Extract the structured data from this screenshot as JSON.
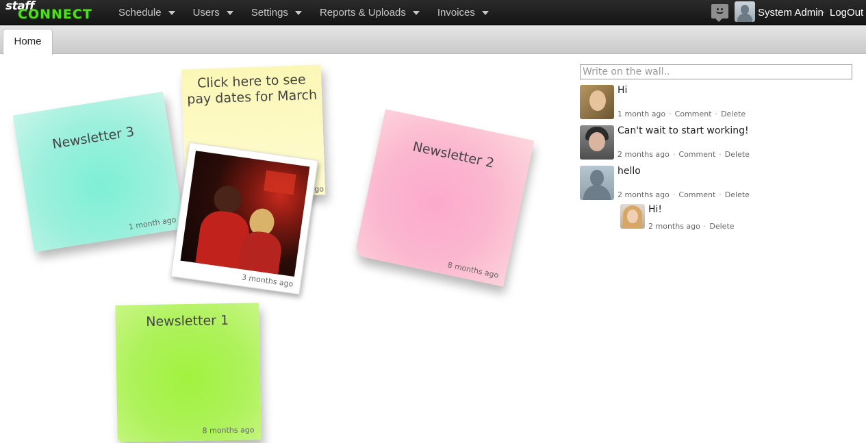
{
  "brand": {
    "line1": "staff",
    "line2": "CONNECT"
  },
  "nav": {
    "items": [
      {
        "label": "Schedule"
      },
      {
        "label": "Users"
      },
      {
        "label": "Settings"
      },
      {
        "label": "Reports & Uploads"
      },
      {
        "label": "Invoices"
      }
    ],
    "user_name": "System Admin",
    "separator": "·",
    "logout_label": "LogOut",
    "messages_icon": "chat-smiley-icon",
    "user_avatar_icon": "user-silhouette-icon"
  },
  "tabs": {
    "home": "Home"
  },
  "notes": {
    "newsletter3": {
      "title": "Newsletter 3",
      "time": "1 month ago",
      "color": "#8ff0d8"
    },
    "paydates": {
      "title": "Click here to see pay dates for March",
      "time": "ago",
      "color": "#fdf9c0"
    },
    "newsletter2": {
      "title": "Newsletter 2",
      "time": "8 months ago",
      "color": "#fbb5cf"
    },
    "newsletter1": {
      "title": "Newsletter 1",
      "time": "8 months ago",
      "color": "#a8f24c"
    },
    "photo": {
      "time": "3 months ago"
    }
  },
  "wall": {
    "placeholder": "Write on the wall..",
    "posts": [
      {
        "text": "Hi",
        "time": "1 month ago",
        "comment": "Comment",
        "delete": "Delete"
      },
      {
        "text": "Can't wait to start working!",
        "time": "2 months ago",
        "comment": "Comment",
        "delete": "Delete"
      },
      {
        "text": "hello",
        "time": "2 months ago",
        "comment": "Comment",
        "delete": "Delete"
      }
    ],
    "reply": {
      "text": "Hi!",
      "time": "2 months ago",
      "delete": "Delete"
    },
    "meta_separator": "·"
  }
}
